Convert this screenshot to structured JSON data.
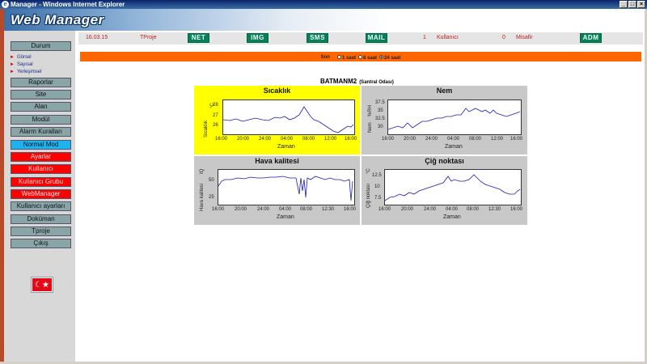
{
  "window": {
    "title": "Manager - Windows Internet Explorer",
    "buttons": [
      "_",
      "□",
      "×"
    ]
  },
  "app": {
    "logo": "Web Manager"
  },
  "topbar": {
    "date": "16.03.15",
    "project": "TProje",
    "buttons": [
      "NET",
      "IMG",
      "SMS",
      "MAIL"
    ],
    "user_count": "1",
    "user_label": "Kullanıcı",
    "guest_count": "0",
    "guest_label": "Misafir",
    "admin_button": "ADM"
  },
  "sidebar": {
    "durum": "Durum",
    "sub_items": [
      "Görsel",
      "Sayısal",
      "Yerleşimsel"
    ],
    "items": [
      {
        "label": "Raporlar",
        "color": "#8aa5a8"
      },
      {
        "label": "Site",
        "color": "#8aa5a8"
      },
      {
        "label": "Alan",
        "color": "#8aa5a8"
      },
      {
        "label": "Modül",
        "color": "#8aa5a8"
      },
      {
        "label": "Alarm Kuralları",
        "color": "#8aa5a8"
      },
      {
        "label": "Normal Mod",
        "color": "#1fb2f0"
      },
      {
        "label": "Ayarlar",
        "color": "#ff0000"
      },
      {
        "label": "Kullanıcı",
        "color": "#ff0000"
      },
      {
        "label": "Kullanıcı Grubu",
        "color": "#ff0000"
      },
      {
        "label": "WebManager",
        "color": "#ff0000"
      },
      {
        "label": "Kullanıcı ayarları",
        "color": "#8aa5a8"
      },
      {
        "label": "Doküman",
        "color": "#8aa5a8"
      },
      {
        "label": "Tproje",
        "color": "#8aa5a8"
      },
      {
        "label": "Çıkış",
        "color": "#8aa5a8"
      }
    ],
    "flag": "☾★"
  },
  "filter": {
    "label": "Son",
    "options": [
      "1 saat",
      "8 saat",
      "24 saat"
    ],
    "selected": "24 saat"
  },
  "station": {
    "name": "BATMANM2",
    "room": "(Santral Odası)"
  },
  "charts": [
    {
      "title": "Sıcaklık",
      "ylabel": "Sıcaklık",
      "unit": "°C",
      "xlabel": "Zaman",
      "highlight": true,
      "yticks": [
        "28",
        "27",
        "26"
      ],
      "xticks": [
        "16:00",
        "20:00",
        "24:00",
        "04:00",
        "08:00",
        "12:00",
        "16:00"
      ]
    },
    {
      "title": "Nem",
      "ylabel": "Nem",
      "unit": "%RH",
      "xlabel": "Zaman",
      "highlight": false,
      "yticks": [
        "37.5",
        "35",
        "32.5",
        "30"
      ],
      "xticks": [
        "16:00",
        "20:00",
        "24:00",
        "04:00",
        "08:00",
        "12:00",
        "16:00"
      ]
    },
    {
      "title": "Hava kalitesi",
      "ylabel": "Hava kalitesi",
      "unit": "IQ",
      "xlabel": "Zaman",
      "highlight": false,
      "yticks": [
        "50",
        "25"
      ],
      "xticks": [
        "16:00",
        "20:00",
        "24:00",
        "04:00",
        "08:00",
        "12:30",
        "16:00"
      ]
    },
    {
      "title": "Çiğ noktası",
      "ylabel": "Çiğ noktası",
      "unit": "°C",
      "xlabel": "Zaman",
      "highlight": false,
      "yticks": [
        "12.5",
        "10",
        "7.5"
      ],
      "xticks": [
        "16:00",
        "20:00",
        "24:00",
        "04:00",
        "08:00",
        "12:30",
        "16:00"
      ]
    }
  ],
  "colors": {
    "accent_orange": "#ff6600",
    "series_line": "#1c1cb4",
    "button_green": "#0a7f5c",
    "highlight": "#ffff00"
  }
}
